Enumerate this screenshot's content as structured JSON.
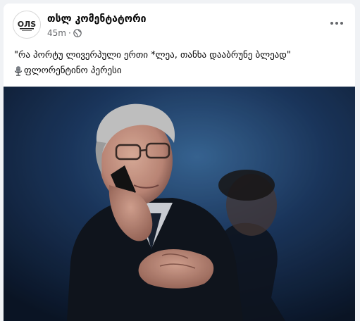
{
  "post": {
    "page_name": "თსლ კომენტატორი",
    "time": "45m",
    "separator": "·",
    "audience_icon": "globe-icon",
    "menu_icon": "more-options-icon",
    "avatar_logo_text": "ОЛS",
    "caption_quote": "\"რა პორტუ ლივერპული ერთი *ლეა, თანხა დააბრუნე ბლეად\"",
    "caption_author_icon": "microphone-icon",
    "caption_author": "ფლორენტინო პერესი",
    "photo_subject": "photo"
  }
}
